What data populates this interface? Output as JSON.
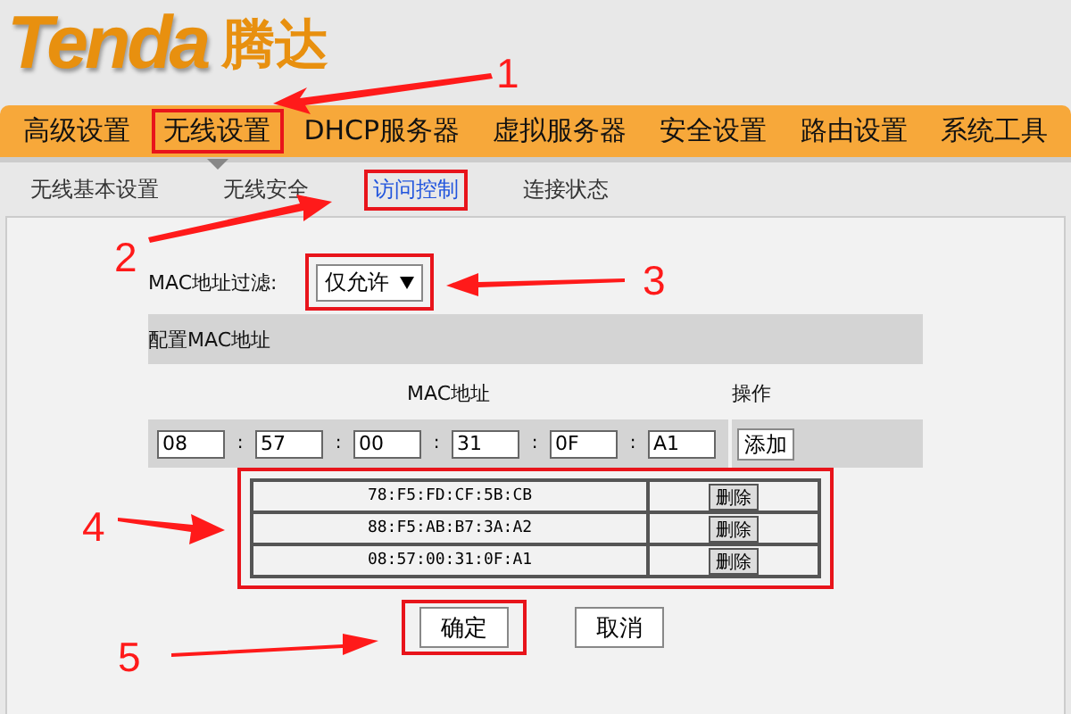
{
  "logo": {
    "brand": "Tenda",
    "name": "腾达"
  },
  "nav": [
    {
      "label": "高级设置",
      "selected": false,
      "highlighted": false
    },
    {
      "label": "无线设置",
      "selected": true,
      "highlighted": true
    },
    {
      "label": "DHCP服务器",
      "selected": false,
      "highlighted": false
    },
    {
      "label": "虚拟服务器",
      "selected": false,
      "highlighted": false
    },
    {
      "label": "安全设置",
      "selected": false,
      "highlighted": false
    },
    {
      "label": "路由设置",
      "selected": false,
      "highlighted": false
    },
    {
      "label": "系统工具",
      "selected": false,
      "highlighted": false
    }
  ],
  "subnav": [
    {
      "label": "无线基本设置",
      "selected": false,
      "highlighted": false
    },
    {
      "label": "无线安全",
      "selected": false,
      "highlighted": false
    },
    {
      "label": "访问控制",
      "selected": true,
      "highlighted": true
    },
    {
      "label": "连接状态",
      "selected": false,
      "highlighted": false
    }
  ],
  "filter": {
    "label": "MAC地址过滤:",
    "value": "仅允许",
    "highlighted": true
  },
  "config": {
    "title": "配置MAC地址",
    "columns": [
      "MAC地址",
      "操作"
    ],
    "octets": [
      {
        "value": "08",
        "separator": ":"
      },
      {
        "value": "57",
        "separator": ":"
      },
      {
        "value": "00",
        "separator": ":"
      },
      {
        "value": "31",
        "separator": ":"
      },
      {
        "value": "0F",
        "separator": ":"
      },
      {
        "value": "A1"
      }
    ],
    "add_button": "添加"
  },
  "mac_list": {
    "highlighted": true,
    "rows": [
      {
        "mac": "78:F5:FD:CF:5B:CB",
        "action": "删除"
      },
      {
        "mac": "88:F5:AB:B7:3A:A2",
        "action": "删除"
      },
      {
        "mac": "08:57:00:31:0F:A1",
        "action": "删除"
      }
    ]
  },
  "buttons": [
    {
      "label": "确定",
      "highlighted": true
    },
    {
      "label": "取消",
      "highlighted": false
    }
  ],
  "annotations": [
    {
      "label": "1"
    },
    {
      "label": "2"
    },
    {
      "label": "3"
    },
    {
      "label": "4"
    },
    {
      "label": "5"
    }
  ]
}
